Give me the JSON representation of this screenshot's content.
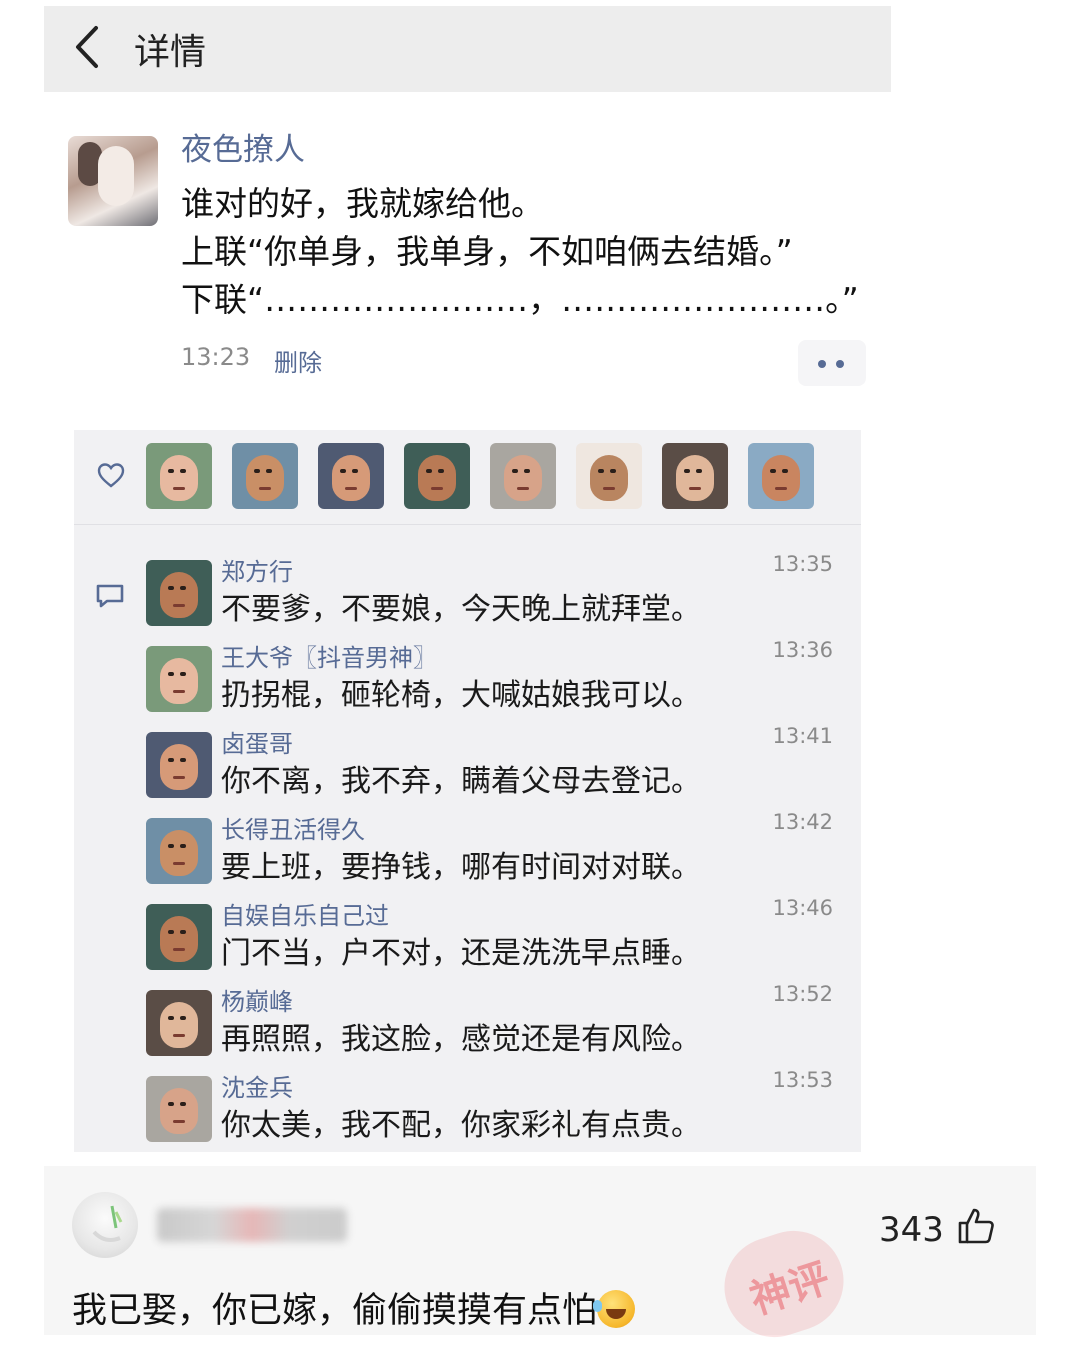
{
  "topbar": {
    "title": "详情"
  },
  "post": {
    "author": "夜色撩人",
    "lines": [
      "谁对的好，我就嫁给他。",
      "上联“你单身，我单身，不如咱俩去结婚。”",
      "下联“……………………，……………………。”"
    ],
    "time": "13:23",
    "delete_label": "删除"
  },
  "likes": {
    "avatars": [
      "like-avatar-1",
      "like-avatar-2",
      "like-avatar-3",
      "like-avatar-4",
      "like-avatar-5",
      "like-avatar-6",
      "like-avatar-7",
      "like-avatar-8"
    ]
  },
  "comments": [
    {
      "name": "郑方行",
      "text": "不要爹，不要娘，今天晚上就拜堂。",
      "time": "13:35"
    },
    {
      "name": "王大爷〖抖音男神〗",
      "text": "扔拐棍，砸轮椅，大喊姑娘我可以。",
      "time": "13:36"
    },
    {
      "name": "卤蛋哥",
      "text": "你不离，我不弃，瞒着父母去登记。",
      "time": "13:41"
    },
    {
      "name": "长得丑活得久",
      "text": "要上班，要挣钱，哪有时间对对联。",
      "time": "13:42"
    },
    {
      "name": "自娱自乐自己过",
      "text": "门不当，户不对，还是洗洗早点睡。",
      "time": "13:46"
    },
    {
      "name": "杨巅峰",
      "text": "再照照，我这脸，感觉还是有风险。",
      "time": "13:52"
    },
    {
      "name": "沈金兵",
      "text": "你太美，我不配，你家彩礼有点贵。",
      "time": "13:53"
    }
  ],
  "bottom": {
    "like_count": "343",
    "comment": "我已娶，你已嫁，偷偷摸摸有点怕",
    "stamp_text": "神评"
  }
}
